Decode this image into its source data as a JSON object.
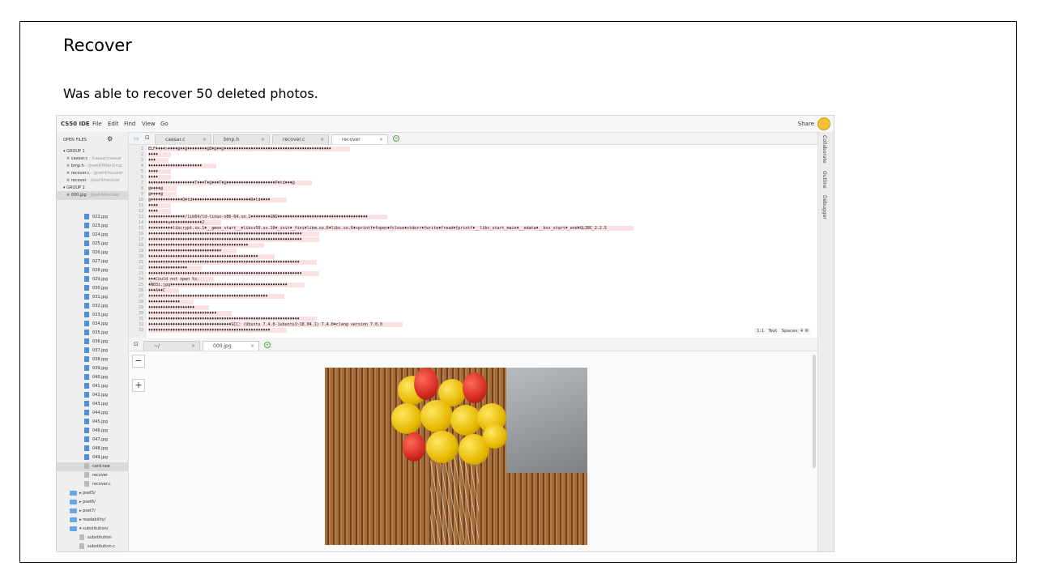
{
  "slide": {
    "title": "Recover",
    "subtitle": "Was able to recover 50 deleted photos."
  },
  "ide": {
    "brand": "CS50 IDE",
    "menu": [
      "File",
      "Edit",
      "Find",
      "View",
      "Go"
    ],
    "share": "Share",
    "sidebar_header": "OPEN FILES",
    "open_files": [
      {
        "label": "GROUP 1",
        "type": "group"
      },
      {
        "label": "caesar.c",
        "path": "- /caesar/caesar"
      },
      {
        "label": "bmp.h",
        "path": "- /pset4/filter/bmp"
      },
      {
        "label": "recover.c",
        "path": "- /pset4/recover"
      },
      {
        "label": "recover",
        "path": "- /pset4/recover"
      },
      {
        "label": "GROUP 2",
        "type": "group"
      },
      {
        "label": "000.jpg",
        "path": "- /pset4/recover"
      }
    ],
    "jpg_files": [
      "022.jpg",
      "023.jpg",
      "024.jpg",
      "025.jpg",
      "026.jpg",
      "027.jpg",
      "028.jpg",
      "029.jpg",
      "030.jpg",
      "031.jpg",
      "032.jpg",
      "033.jpg",
      "034.jpg",
      "035.jpg",
      "036.jpg",
      "037.jpg",
      "038.jpg",
      "039.jpg",
      "040.jpg",
      "041.jpg",
      "042.jpg",
      "043.jpg",
      "044.jpg",
      "045.jpg",
      "046.jpg",
      "047.jpg",
      "048.jpg",
      "049.jpg"
    ],
    "other_files": [
      "card.raw",
      "recover",
      "recover.c"
    ],
    "folders": [
      "pset5/",
      "pset6/",
      "pset7/",
      "readability/",
      "substitution/"
    ],
    "subfiles": [
      "substitution",
      "substitution.c"
    ],
    "editor_tabs": [
      "caesar.c",
      "bmp.h",
      "recover.c",
      "recover"
    ],
    "code_lines": [
      "ELF♦♦♦♦>♦♦♦♦@♦♦@♦♦♦♦♦♦♦♦@8♦@♦♦@♦♦♦♦♦♦♦♦♦♦♦♦♦♦♦♦♦♦♦♦♦♦♦♦♦♦♦♦♦♦♦♦♦♦♦♦♦♦♦♦♦♦♦♦",
      "♦♦♦♦",
      "♦♦♦",
      "♦♦♦♦♦♦♦♦♦♦♦♦♦♦♦♦♦♦♦♦♦♦",
      "♦♦♦♦",
      "♦♦♦♦",
      "♦♦♦♦♦♦♦♦♦♦♦♦♦♦♦♦♦♦♦T♦♦♦T♦@♦♦♦T♦@♦♦♦♦♦♦♦♦♦♦♦♦♦♦♦♦♦♦♦♦P♦td♦♦♦@",
      "@♦♦♦♦@",
      "@♦♦♦♦@",
      "@♦♦♦♦♦♦♦♦♦♦♦♦♦Q♦td♦♦♦♦♦♦♦♦♦♦♦♦♦♦♦♦♦♦♦♦♦♦♦♦R♦td♦♦♦♦",
      "♦♦♦♦",
      "♦♦♦♦",
      "♦♦♦♦♦♦♦♦♦♦♦♦♦♦♦/lib64/ld-linux-x86-64.so.2♦♦♦♦♦♦♦♦GNU♦♦♦♦♦♦♦♦♦♦♦♦♦♦♦♦♦♦♦♦♦♦♦♦♦♦♦♦♦♦♦♦♦♦♦♦♦",
      "♦♦♦♦♦♦♦♦a♦♦♦♦♦♦♦♦♦♦♦♦♦⁦2",
      "♦♦♦♦♦♦♦♦♦♦libcrypt.so.1♦__gmon_start__♦libcs50.so.10♦_init♦_fini♦libm.so.6♦libc.so.6♦sprintf♦fopen♦fclose♦stderr♦fwrite♦fread♦fprintf♦__libc_start_main♦__edata♦__bss_start♦_end♦GLIBC_2.2.5",
      "♦♦♦♦♦♦♦♦♦♦♦♦♦♦♦♦♦♦♦♦♦♦♦♦♦♦♦♦♦♦♦♦♦♦♦♦♦♦♦♦♦♦♦♦♦♦♦♦♦♦♦♦♦♦♦♦♦♦♦♦♦♦♦",
      "♦♦♦♦♦♦♦♦♦♦♦♦♦♦♦♦♦♦♦♦♦♦♦♦♦♦♦♦♦♦♦♦♦♦♦♦♦♦♦♦♦♦♦♦♦♦♦♦♦♦♦♦♦♦♦♦♦♦♦♦♦♦♦",
      "♦♦♦♦♦♦♦♦♦♦♦♦♦♦♦♦♦♦♦♦♦♦♦♦♦♦♦♦♦♦♦♦♦♦♦♦♦♦♦♦♦",
      "♦♦♦♦♦♦♦♦♦♦♦♦♦♦♦♦♦♦♦♦♦♦♦♦♦♦♦♦♦♦",
      "♦♦♦♦♦♦♦♦♦♦♦♦♦♦♦♦♦♦♦♦♦♦♦♦♦♦♦♦♦♦♦♦♦♦♦♦♦♦♦♦♦♦♦♦♦",
      "♦♦♦♦♦♦♦♦♦♦♦♦♦♦♦♦♦♦♦♦♦♦♦♦♦♦♦♦♦♦♦♦♦♦♦♦♦♦♦♦♦♦♦♦♦♦♦♦♦♦♦♦♦♦♦♦♦♦♦♦♦♦",
      "♦♦♦♦♦♦♦♦♦♦♦♦♦♦♦♦",
      "♦♦♦♦♦♦♦♦♦♦♦♦♦♦♦♦♦♦♦♦♦♦♦♦♦♦♦♦♦♦♦♦♦♦♦♦♦♦♦♦♦♦♦♦♦♦♦♦♦♦♦♦♦♦♦♦♦♦♦♦♦♦♦",
      "♦♦♦Could not open %s.",
      "♦N03i.jpg♦♦♦♦♦♦♦♦♦♦♦♦♦♦♦♦♦♦♦♦♦♦♦♦♦♦♦♦♦♦♦♦♦♦♦♦♦♦♦♦♦♦♦♦♦♦♦♦",
      "♦♦♦A♦♦C",
      "♦♦♦♦♦♦♦♦♦♦♦♦♦♦♦♦♦♦♦♦♦♦♦♦♦♦♦♦♦♦♦♦♦♦♦♦♦♦♦♦♦♦♦♦♦♦♦♦♦",
      "♦♦♦♦♦♦♦♦♦♦♦♦♦",
      "♦♦♦♦♦♦♦♦♦♦♦♦♦♦♦♦♦♦♦",
      "♦♦♦♦♦♦♦♦♦♦♦♦♦♦♦♦♦♦♦♦♦♦♦♦♦♦♦♦",
      "♦♦♦♦♦♦♦♦♦♦♦♦♦♦♦♦♦♦♦♦♦♦♦♦♦♦♦♦♦♦♦♦♦♦♦♦♦♦♦♦♦♦♦♦♦♦♦♦♦♦♦♦♦♦♦♦♦♦♦♦♦♦",
      "♦♦♦♦♦♦♦♦♦♦♦♦♦♦♦♦♦♦♦♦♦♦♦♦♦♦♦♦♦♦♦♦♦♦GCC: (Ubuntu 7.4.0-1ubuntu1~18.04.1) 7.4.0♦clang version 7.0.0",
      "♦♦♦♦♦♦♦♦♦♦♦♦♦♦♦♦♦♦♦♦♦♦♦♦♦♦♦♦♦♦♦♦♦♦♦♦♦♦♦♦♦♦♦♦♦♦♦♦♦♦"
    ],
    "status": {
      "pos": "1:1",
      "mode": "Text",
      "spaces": "Spaces: 4"
    },
    "right_panels": [
      "Collaborate",
      "Outline",
      "Debugger"
    ],
    "bottom_tabs": [
      "~/",
      "000.jpg"
    ],
    "zoom_in": "+",
    "zoom_out": "−"
  }
}
